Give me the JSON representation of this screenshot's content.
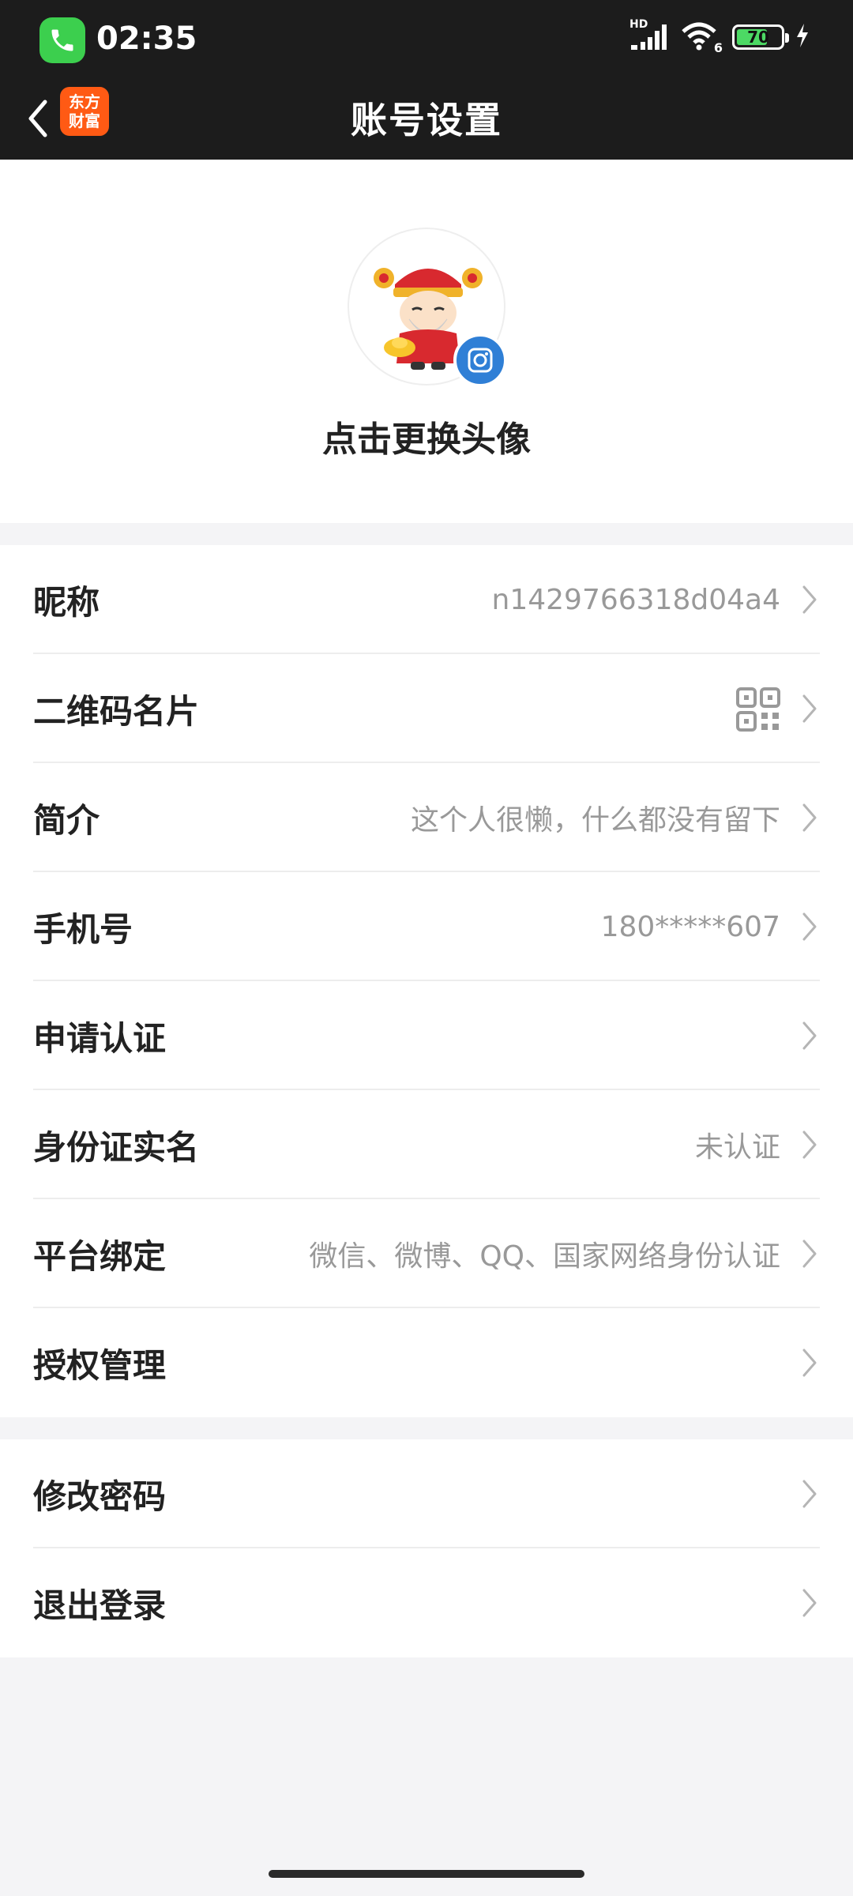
{
  "status_bar": {
    "time": "02:35",
    "network": "HD",
    "wifi_badge": "6",
    "battery": "70",
    "battery_level": 0.7,
    "icons": [
      "phone-icon",
      "signal-icon",
      "wifi-icon",
      "battery-icon",
      "charging-icon"
    ]
  },
  "nav": {
    "title": "账号设置",
    "logo_line1": "东方",
    "logo_line2": "财富",
    "back_icon": "chevron-left-icon"
  },
  "avatar": {
    "caption": "点击更换头像",
    "badge_icon": "camera-icon"
  },
  "settings": {
    "group1": [
      {
        "label": "昵称",
        "value": "n1429766318d04a4"
      },
      {
        "label": "二维码名片",
        "value": "",
        "icon": "qr-code-icon"
      },
      {
        "label": "简介",
        "value": "这个人很懒，什么都没有留下"
      },
      {
        "label": "手机号",
        "value": "180*****607"
      },
      {
        "label": "申请认证",
        "value": ""
      },
      {
        "label": "身份证实名",
        "value": "未认证"
      },
      {
        "label": "平台绑定",
        "value": "微信、微博、QQ、国家网络身份认证"
      },
      {
        "label": "授权管理",
        "value": ""
      }
    ],
    "group2": [
      {
        "label": "修改密码",
        "value": ""
      },
      {
        "label": "退出登录",
        "value": ""
      }
    ]
  },
  "colors": {
    "header_bg": "#1c1c1c",
    "logo_orange": "#ff5a14",
    "badge_blue": "#2f7fd6",
    "call_green": "#3ccf4e",
    "battery_green": "#4cd964",
    "value_gray": "#999999",
    "page_bg": "#f4f4f6"
  }
}
